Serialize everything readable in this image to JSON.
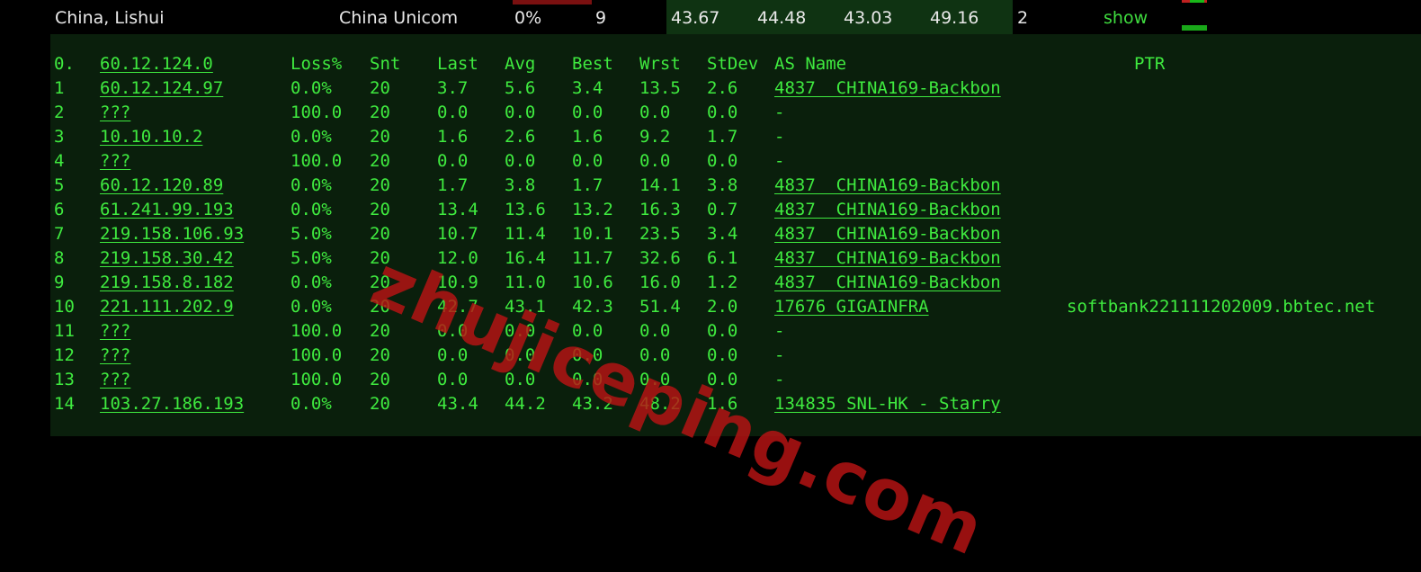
{
  "summary": {
    "location": "China, Lishui",
    "isp": "China Unicom",
    "loss": "0%",
    "sent": "9",
    "last": "43.67",
    "avg": "44.48",
    "best": "43.03",
    "worst": "49.16",
    "stdev": "2",
    "show_label": "show",
    "colors": {
      "ping_bg": "#0f3312",
      "loss_swatch": "#7a1010",
      "link": "#3fdc3f"
    }
  },
  "terminal": {
    "header": {
      "hop": "0.",
      "host": "60.12.124.0",
      "loss": "Loss%",
      "snt": "Snt",
      "last": "Last",
      "avg": "Avg",
      "best": "Best",
      "wrst": "Wrst",
      "stdev": "StDev",
      "as": "AS Name",
      "ptr": "PTR"
    },
    "rows": [
      {
        "hop": "1",
        "host": "60.12.124.97",
        "loss": "0.0%",
        "snt": "20",
        "last": "3.7",
        "avg": "5.6",
        "best": "3.4",
        "wrst": "13.5",
        "stdev": "2.6",
        "as": "4837  CHINA169-Backbon",
        "ptr": ""
      },
      {
        "hop": "2",
        "host": "???",
        "loss": "100.0",
        "snt": "20",
        "last": "0.0",
        "avg": "0.0",
        "best": "0.0",
        "wrst": "0.0",
        "stdev": "0.0",
        "as": "-",
        "ptr": ""
      },
      {
        "hop": "3",
        "host": "10.10.10.2",
        "loss": "0.0%",
        "snt": "20",
        "last": "1.6",
        "avg": "2.6",
        "best": "1.6",
        "wrst": "9.2",
        "stdev": "1.7",
        "as": "-",
        "ptr": ""
      },
      {
        "hop": "4",
        "host": "???",
        "loss": "100.0",
        "snt": "20",
        "last": "0.0",
        "avg": "0.0",
        "best": "0.0",
        "wrst": "0.0",
        "stdev": "0.0",
        "as": "-",
        "ptr": ""
      },
      {
        "hop": "5",
        "host": "60.12.120.89",
        "loss": "0.0%",
        "snt": "20",
        "last": "1.7",
        "avg": "3.8",
        "best": "1.7",
        "wrst": "14.1",
        "stdev": "3.8",
        "as": "4837  CHINA169-Backbon",
        "ptr": ""
      },
      {
        "hop": "6",
        "host": "61.241.99.193",
        "loss": "0.0%",
        "snt": "20",
        "last": "13.4",
        "avg": "13.6",
        "best": "13.2",
        "wrst": "16.3",
        "stdev": "0.7",
        "as": "4837  CHINA169-Backbon",
        "ptr": ""
      },
      {
        "hop": "7",
        "host": "219.158.106.93",
        "loss": "5.0%",
        "snt": "20",
        "last": "10.7",
        "avg": "11.4",
        "best": "10.1",
        "wrst": "23.5",
        "stdev": "3.4",
        "as": "4837  CHINA169-Backbon",
        "ptr": ""
      },
      {
        "hop": "8",
        "host": "219.158.30.42",
        "loss": "5.0%",
        "snt": "20",
        "last": "12.0",
        "avg": "16.4",
        "best": "11.7",
        "wrst": "32.6",
        "stdev": "6.1",
        "as": "4837  CHINA169-Backbon",
        "ptr": ""
      },
      {
        "hop": "9",
        "host": "219.158.8.182",
        "loss": "0.0%",
        "snt": "20",
        "last": "10.9",
        "avg": "11.0",
        "best": "10.6",
        "wrst": "16.0",
        "stdev": "1.2",
        "as": "4837  CHINA169-Backbon",
        "ptr": ""
      },
      {
        "hop": "10",
        "host": "221.111.202.9",
        "loss": "0.0%",
        "snt": "20",
        "last": "42.7",
        "avg": "43.1",
        "best": "42.3",
        "wrst": "51.4",
        "stdev": "2.0",
        "as": "17676 GIGAINFRA",
        "ptr": "softbank221111202009.bbtec.net"
      },
      {
        "hop": "11",
        "host": "???",
        "loss": "100.0",
        "snt": "20",
        "last": "0.0",
        "avg": "0.0",
        "best": "0.0",
        "wrst": "0.0",
        "stdev": "0.0",
        "as": "-",
        "ptr": ""
      },
      {
        "hop": "12",
        "host": "???",
        "loss": "100.0",
        "snt": "20",
        "last": "0.0",
        "avg": "0.0",
        "best": "0.0",
        "wrst": "0.0",
        "stdev": "0.0",
        "as": "-",
        "ptr": ""
      },
      {
        "hop": "13",
        "host": "???",
        "loss": "100.0",
        "snt": "20",
        "last": "0.0",
        "avg": "0.0",
        "best": "0.0",
        "wrst": "0.0",
        "stdev": "0.0",
        "as": "-",
        "ptr": ""
      },
      {
        "hop": "14",
        "host": "103.27.186.193",
        "loss": "0.0%",
        "snt": "20",
        "last": "43.4",
        "avg": "44.2",
        "best": "43.2",
        "wrst": "48.2",
        "stdev": "1.6",
        "as": "134835 SNL-HK - Starry",
        "ptr": ""
      }
    ],
    "colors": {
      "text": "#3fea3f",
      "background": "#0a1f0c"
    }
  },
  "watermark": {
    "text": "zhujiceping.com",
    "color": "#b91414"
  }
}
